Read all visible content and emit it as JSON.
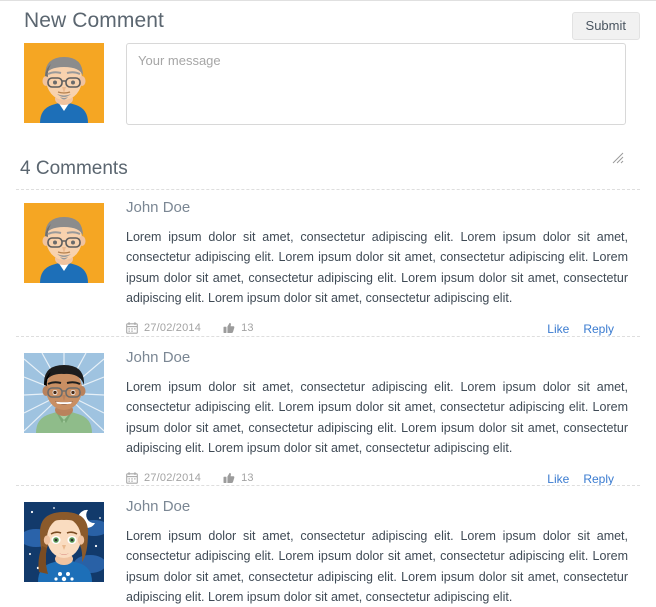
{
  "header": {
    "title": "New Comment",
    "submit_label": "Submit"
  },
  "new_comment_form": {
    "avatar_name": "user-avatar-orange-man",
    "message_placeholder": "Your message",
    "message_value": ""
  },
  "comments_section": {
    "heading": "4 Comments",
    "count": 4,
    "comments": [
      {
        "author": "John Doe",
        "avatar_name": "avatar-orange-gray-haired-man-glasses",
        "text": "Lorem ipsum dolor sit amet, consectetur adipiscing elit. Lorem ipsum dolor sit amet, consectetur adipiscing elit. Lorem ipsum dolor sit amet, consectetur adipiscing elit. Lorem ipsum dolor sit amet, consectetur adipiscing elit. Lorem ipsum dolor sit amet, consectetur adipiscing elit. Lorem ipsum dolor sit amet, consectetur adipiscing elit.",
        "date": "27/02/2014",
        "likes": "13",
        "like_label": "Like",
        "reply_label": "Reply"
      },
      {
        "author": "John Doe",
        "avatar_name": "avatar-blue-burst-man-green-shirt",
        "text": "Lorem ipsum dolor sit amet, consectetur adipiscing elit. Lorem ipsum dolor sit amet, consectetur adipiscing elit. Lorem ipsum dolor sit amet, consectetur adipiscing elit. Lorem ipsum dolor sit amet, consectetur adipiscing elit. Lorem ipsum dolor sit amet, consectetur adipiscing elit. Lorem ipsum dolor sit amet, consectetur adipiscing elit.",
        "date": "27/02/2014",
        "likes": "13",
        "like_label": "Like",
        "reply_label": "Reply"
      },
      {
        "author": "John Doe",
        "avatar_name": "avatar-night-sky-woman-brown-hair",
        "text": "Lorem ipsum dolor sit amet, consectetur adipiscing elit. Lorem ipsum dolor sit amet, consectetur adipiscing elit. Lorem ipsum dolor sit amet, consectetur adipiscing elit. Lorem ipsum dolor sit amet, consectetur adipiscing elit. Lorem ipsum dolor sit amet, consectetur adipiscing elit. Lorem ipsum dolor sit amet, consectetur adipiscing elit.",
        "date": "",
        "likes": "",
        "like_label": "",
        "reply_label": ""
      }
    ]
  },
  "icons": {
    "calendar": "calendar-icon",
    "thumbs_up": "thumbs-up-icon",
    "resize_grip": "resize-grip-icon"
  },
  "colors": {
    "link": "#3a7bd0",
    "heading": "#5b6670",
    "author": "#7b8794",
    "body_text": "#3f4a55",
    "meta_text": "#a3a3a3",
    "divider": "#dedede",
    "button_bg": "#f1f1f1"
  }
}
